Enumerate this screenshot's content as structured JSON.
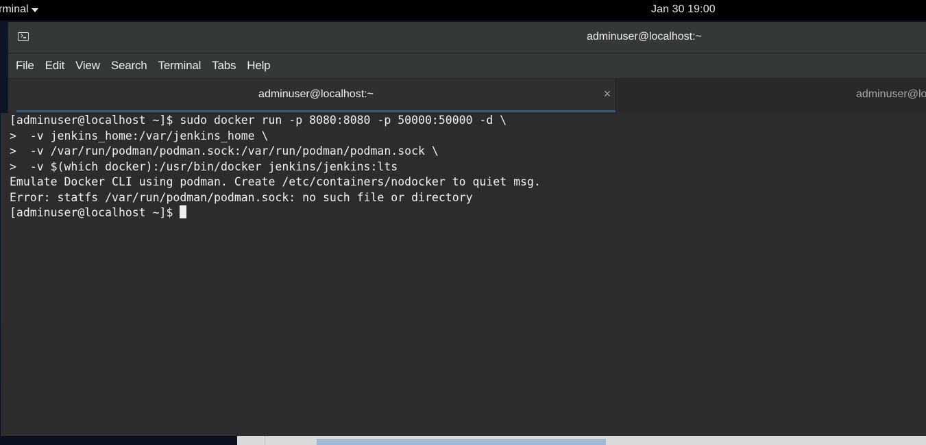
{
  "topbar": {
    "app_menu_label": "rminal",
    "clock": "Jan 30  19:00"
  },
  "window": {
    "title": "adminuser@localhost:~",
    "icon": "terminal-icon"
  },
  "menubar": {
    "items": [
      "File",
      "Edit",
      "View",
      "Search",
      "Terminal",
      "Tabs",
      "Help"
    ]
  },
  "tabs": [
    {
      "label": "adminuser@localhost:~",
      "active": true,
      "close_glyph": "×"
    },
    {
      "label": "adminuser@localhost:~",
      "active": false
    }
  ],
  "terminal": {
    "lines": [
      "[adminuser@localhost ~]$ sudo docker run -p 8080:8080 -p 50000:50000 -d \\",
      ">  -v jenkins_home:/var/jenkins_home \\",
      ">  -v /var/run/podman/podman.sock:/var/run/podman/podman.sock \\",
      ">  -v $(which docker):/usr/bin/docker jenkins/jenkins:lts",
      "Emulate Docker CLI using podman. Create /etc/containers/nodocker to quiet msg.",
      "Error: statfs /var/run/podman/podman.sock: no such file or directory"
    ],
    "prompt": "[adminuser@localhost ~]$ "
  },
  "colors": {
    "tab_underline": "#215d9c",
    "terminal_bg": "#2c2c2c",
    "terminal_fg": "#f0f0f0"
  }
}
